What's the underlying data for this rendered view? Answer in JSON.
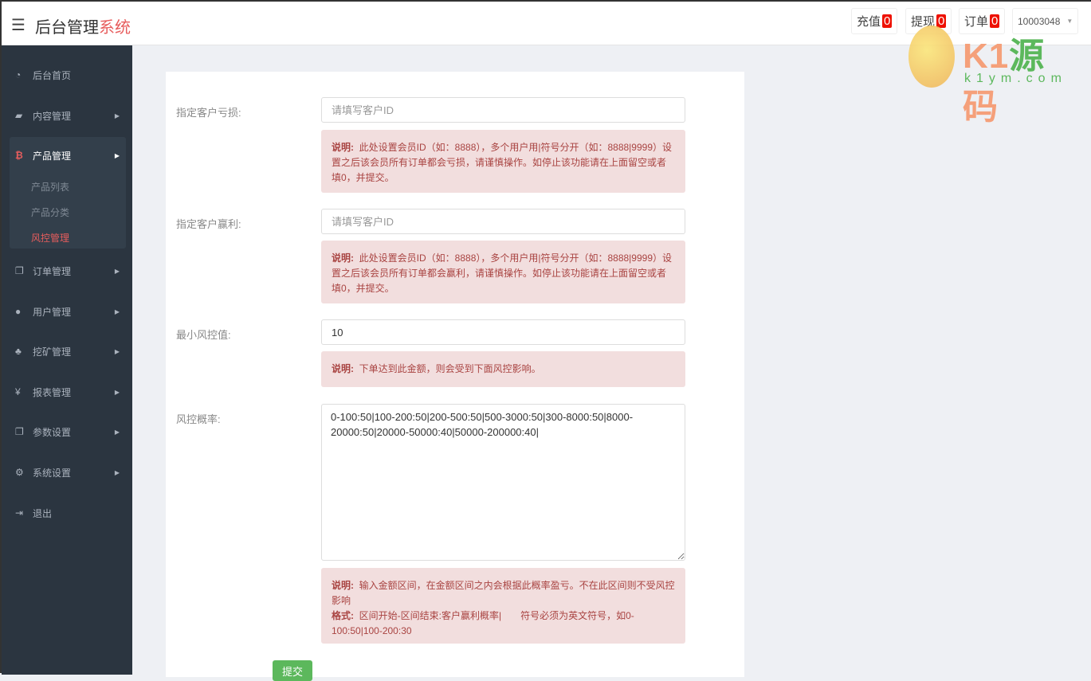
{
  "header": {
    "brand_main": "后台管理",
    "brand_accent": "系统",
    "buttons": [
      {
        "label": "充值",
        "count": "0"
      },
      {
        "label": "提现",
        "count": "0"
      },
      {
        "label": "订单",
        "count": "0"
      }
    ],
    "user": "10003048"
  },
  "sidebar": {
    "items": [
      {
        "label": "后台首页",
        "icon": "dashboard-icon"
      },
      {
        "label": "内容管理",
        "icon": "book-icon"
      },
      {
        "label": "产品管理",
        "icon": "bitcoin-icon"
      },
      {
        "label": "订单管理",
        "icon": "copy-icon"
      },
      {
        "label": "用户管理",
        "icon": "user-icon"
      },
      {
        "label": "挖矿管理",
        "icon": "sitemap-icon"
      },
      {
        "label": "报表管理",
        "icon": "yen-icon"
      },
      {
        "label": "参数设置",
        "icon": "copy-icon"
      },
      {
        "label": "系统设置",
        "icon": "gears-icon"
      },
      {
        "label": "退出",
        "icon": "sign-out-icon"
      }
    ],
    "sub": [
      "产品列表",
      "产品分类",
      "风控管理"
    ]
  },
  "form": {
    "loss": {
      "label": "指定客户亏损:",
      "placeholder": "请填写客户ID",
      "note_title": "说明:",
      "note": "此处设置会员ID（如：8888），多个用户用|符号分开（如：8888|9999）设置之后该会员所有订单都会亏损，请谨慎操作。如停止该功能请在上面留空或者填0，并提交。"
    },
    "win": {
      "label": "指定客户赢利:",
      "placeholder": "请填写客户ID",
      "note_title": "说明:",
      "note": "此处设置会员ID（如：8888），多个用户用|符号分开（如：8888|9999）设置之后该会员所有订单都会赢利，请谨慎操作。如停止该功能请在上面留空或者填0，并提交。"
    },
    "min": {
      "label": "最小风控值:",
      "value": "10",
      "note_title": "说明:",
      "note": "下单达到此金额，则会受到下面风控影响。"
    },
    "rate": {
      "label": "风控概率:",
      "value": "0-100:50|100-200:50|200-500:50|500-3000:50|300-8000:50|8000-20000:50|20000-50000:40|50000-200000:40|",
      "note_title": "说明:",
      "note": "输入金额区间，在金额区间之内会根据此概率盈亏。不在此区间则不受风控影响",
      "format_title": "格式:",
      "format": "区间开始-区间结束:客户赢利概率|　　符号必须为英文符号，如0-100:50|100-200:30"
    },
    "submit": "提交"
  },
  "watermark": {
    "text": "K1源码",
    "url": "k1ym.com"
  }
}
